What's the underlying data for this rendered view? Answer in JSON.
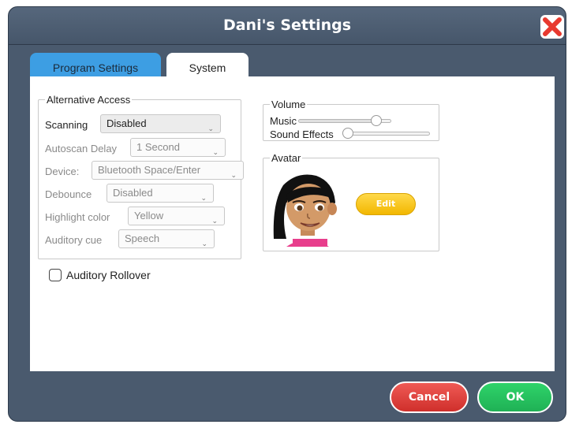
{
  "window": {
    "title": "Dani's Settings"
  },
  "tabs": [
    {
      "label": "Program Settings"
    },
    {
      "label": "System"
    }
  ],
  "alternative_access": {
    "legend": "Alternative Access",
    "rows": [
      {
        "label": "Scanning",
        "value": "Disabled"
      },
      {
        "label": "Autoscan Delay",
        "value": "1 Second"
      },
      {
        "label": "Device:",
        "value": "Bluetooth Space/Enter"
      },
      {
        "label": "Debounce",
        "value": "Disabled"
      },
      {
        "label": "Highlight color",
        "value": "Yellow"
      },
      {
        "label": "Auditory cue",
        "value": "Speech"
      }
    ]
  },
  "volume": {
    "legend": "Volume",
    "music_label": "Music",
    "music_level": 0.9,
    "sound_effects_label": "Sound Effects",
    "sound_effects_level": 0.0
  },
  "avatar": {
    "legend": "Avatar",
    "edit_label": "Edit"
  },
  "auditory_rollover": {
    "label": "Auditory Rollover",
    "checked": false
  },
  "buttons": {
    "cancel": "Cancel",
    "ok": "OK"
  },
  "colors": {
    "window_bg": "#4a5a6e",
    "tab_active": "#ffffff",
    "tab_inactive": "#3d9ee3",
    "cancel": "#e0403b",
    "ok": "#25c45f",
    "edit": "#f7c518",
    "close": "#e8392f"
  }
}
